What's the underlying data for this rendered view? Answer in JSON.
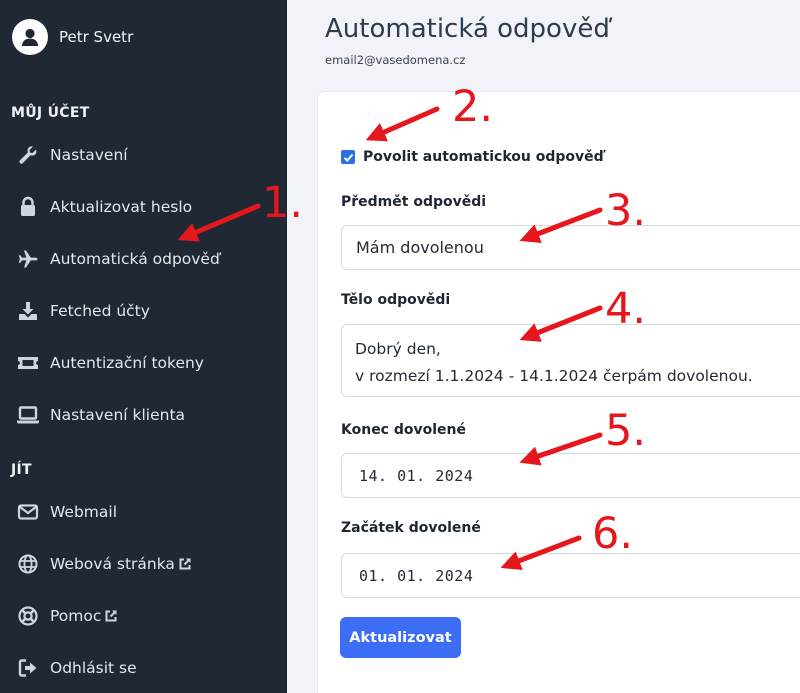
{
  "sidebar": {
    "user_name": "Petr Svetr",
    "section_account": "MŮJ ÚČET",
    "section_go": "JÍT",
    "items": [
      {
        "label": "Nastavení",
        "icon": "wrench-icon"
      },
      {
        "label": "Aktualizovat heslo",
        "icon": "lock-icon"
      },
      {
        "label": "Automatická odpověď",
        "icon": "plane-icon"
      },
      {
        "label": "Fetched účty",
        "icon": "download-icon"
      },
      {
        "label": "Autentizační tokeny",
        "icon": "ticket-icon"
      },
      {
        "label": "Nastavení klienta",
        "icon": "laptop-icon"
      }
    ],
    "go_items": [
      {
        "label": "Webmail",
        "icon": "envelope-icon"
      },
      {
        "label": "Webová stránka",
        "icon": "globe-icon"
      },
      {
        "label": "Pomoc",
        "icon": "lifebuoy-icon"
      },
      {
        "label": "Odhlásit se",
        "icon": "sign-out-icon"
      }
    ]
  },
  "main": {
    "title": "Automatická odpověď",
    "email": "email2@vasedomena.cz",
    "enable_label": "Povolit automatickou odpověď",
    "enable_checked": true,
    "subject_label": "Předmět odpovědi",
    "subject_value": "Mám dovolenou",
    "body_label": "Tělo odpovědi",
    "body_lines": [
      "Dobrý den,",
      "v rozmezí 1.1.2024 - 14.1.2024 čerpám dovolenou."
    ],
    "end_label": "Konec dovolené",
    "end_value": "14. 01. 2024",
    "start_label": "Začátek dovolené",
    "start_value": "01. 01. 2024",
    "submit_label": "Aktualizovat"
  },
  "annotations": [
    "1.",
    "2.",
    "3.",
    "4.",
    "5.",
    "6."
  ],
  "colors": {
    "sidebar_bg": "#1f2833",
    "accent": "#3b6ef5",
    "annotation": "#e5161c"
  }
}
